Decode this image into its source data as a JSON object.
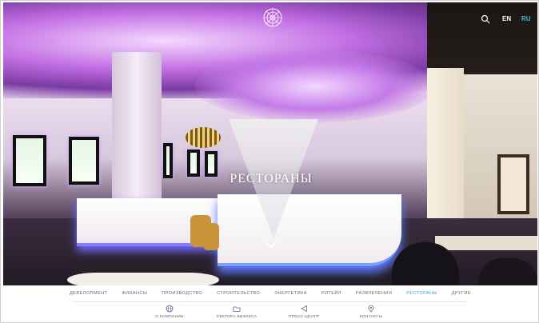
{
  "header": {
    "lang_en": "EN",
    "lang_ru": "RU",
    "logo_icon": "rosette-logo-icon",
    "search_icon": "search-icon"
  },
  "hero": {
    "title": "РЕСТОРАНЫ",
    "scroll_icon": "chevron-down-icon"
  },
  "nav": {
    "items": [
      {
        "label": "ДЕВЕЛОПМЕНТ"
      },
      {
        "label": "ФИНАНСЫ"
      },
      {
        "label": "ПРОИЗВОДСТВО"
      },
      {
        "label": "СТРОИТЕЛЬСТВО"
      },
      {
        "label": "ЭНЕРГЕТИКА"
      },
      {
        "label": "РИТЕЙЛ"
      },
      {
        "label": "РАЗВЛЕЧЕНИЯ"
      },
      {
        "label": "РЕСТОРАНЫ"
      },
      {
        "label": "ДРУГИЕ"
      }
    ],
    "active_index": 7
  },
  "subnav": {
    "items": [
      {
        "label": "О КОМПАНИИ",
        "icon": "globe-icon"
      },
      {
        "label": "СЕКТОРА БИЗНЕСА",
        "icon": "folder-icon"
      },
      {
        "label": "ПРЕСС-ЦЕНТР",
        "icon": "megaphone-icon"
      },
      {
        "label": "КОНТАКТЫ",
        "icon": "map-pin-icon"
      }
    ]
  },
  "colors": {
    "accent": "#3aa9c0",
    "nav_text": "#6a6a6a"
  }
}
